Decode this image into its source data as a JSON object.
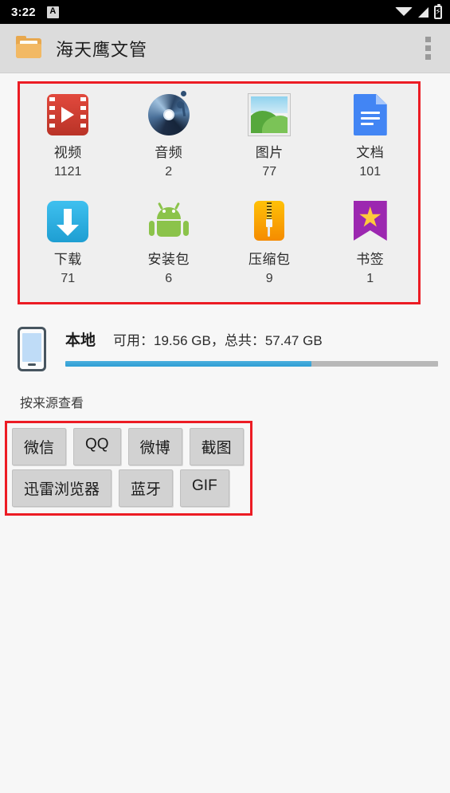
{
  "statusbar": {
    "time": "3:22",
    "ime_badge": "A",
    "icons": [
      "wifi-icon",
      "signal-icon",
      "battery-charging-icon"
    ],
    "battery_glyph": "⚡"
  },
  "appbar": {
    "icon": "folder-icon",
    "title": "海天鹰文管",
    "overflow": "overflow-menu-icon"
  },
  "categories": [
    {
      "icon": "video-icon",
      "label": "视频",
      "count": "1121"
    },
    {
      "icon": "audio-cd-icon",
      "label": "音频",
      "count": "2"
    },
    {
      "icon": "image-icon",
      "label": "图片",
      "count": "77"
    },
    {
      "icon": "document-icon",
      "label": "文档",
      "count": "101"
    },
    {
      "icon": "download-icon",
      "label": "下载",
      "count": "71"
    },
    {
      "icon": "android-apk-icon",
      "label": "安装包",
      "count": "6"
    },
    {
      "icon": "zip-archive-icon",
      "label": "压缩包",
      "count": "9"
    },
    {
      "icon": "bookmark-icon",
      "label": "书签",
      "count": "1"
    }
  ],
  "storage": {
    "icon": "phone-icon",
    "name": "本地",
    "detail": "可用：19.56 GB，总共：57.47 GB",
    "free_gb": "19.56",
    "total_gb": "57.47",
    "used_percent": 66
  },
  "sources": {
    "title": "按来源查看",
    "rows": [
      [
        "微信",
        "QQ",
        "微博",
        "截图"
      ],
      [
        "迅雷浏览器",
        "蓝牙",
        "GIF"
      ]
    ]
  },
  "colors": {
    "accent_red": "#ec1c24",
    "progress_blue": "#2e9fd4",
    "appbar_bg": "#dcdcdc",
    "page_bg": "#f7f7f7",
    "grid_bg": "#efefef"
  }
}
